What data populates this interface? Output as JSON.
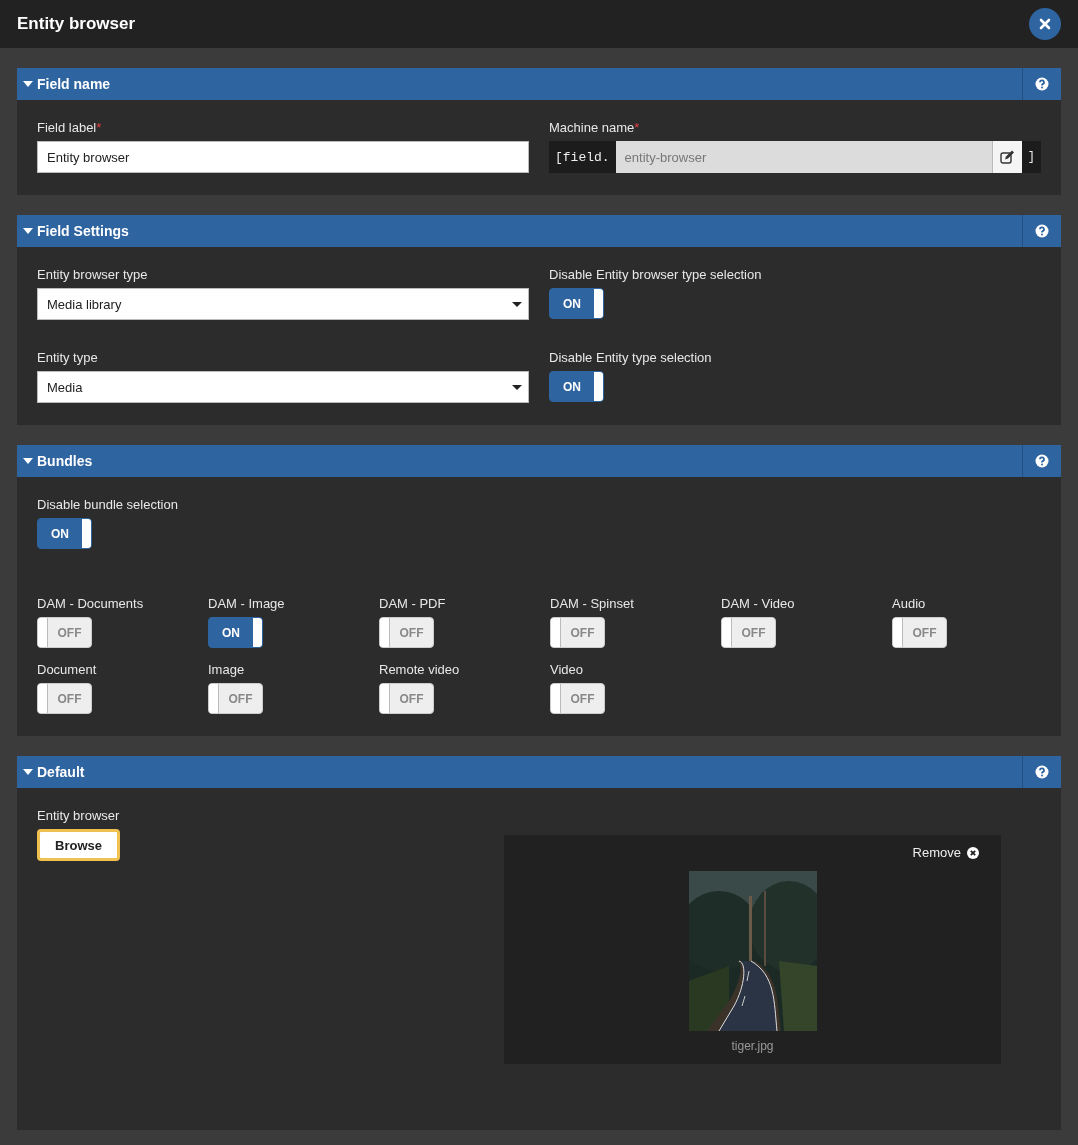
{
  "window": {
    "title": "Entity browser"
  },
  "sections": [
    {
      "kind": "name",
      "title": "Field name",
      "expanded": true,
      "field_label": {
        "label": "Field label",
        "required_mark": "*",
        "value": "Entity browser"
      },
      "machine_name": {
        "label": "Machine name",
        "required_mark": "*",
        "prefix": "[field.",
        "value": "entity-browser",
        "suffix": "]"
      }
    },
    {
      "kind": "settings",
      "title": "Field Settings",
      "expanded": true,
      "rows": [
        {
          "select_label": "Entity browser type",
          "select_value": "Media library",
          "toggle_label": "Disable Entity browser type selection",
          "toggle": {
            "on": true,
            "text": "ON"
          }
        },
        {
          "select_label": "Entity type",
          "select_value": "Media",
          "toggle_label": "Disable Entity type selection",
          "toggle": {
            "on": true,
            "text": "ON"
          }
        }
      ]
    },
    {
      "kind": "bundles",
      "title": "Bundles",
      "expanded": true,
      "master": {
        "label": "Disable bundle selection",
        "on": true,
        "text": "ON"
      },
      "bundles": [
        {
          "label": "DAM - Documents",
          "on": false,
          "text": "OFF"
        },
        {
          "label": "DAM - Image",
          "on": true,
          "text": "ON"
        },
        {
          "label": "DAM - PDF",
          "on": false,
          "text": "OFF"
        },
        {
          "label": "DAM - Spinset",
          "on": false,
          "text": "OFF"
        },
        {
          "label": "DAM - Video",
          "on": false,
          "text": "OFF"
        },
        {
          "label": "Audio",
          "on": false,
          "text": "OFF"
        },
        {
          "label": "Document",
          "on": false,
          "text": "OFF"
        },
        {
          "label": "Image",
          "on": false,
          "text": "OFF"
        },
        {
          "label": "Remote video",
          "on": false,
          "text": "OFF"
        },
        {
          "label": "Video",
          "on": false,
          "text": "OFF"
        }
      ]
    },
    {
      "kind": "default",
      "title": "Default",
      "expanded": true,
      "label": "Entity browser",
      "button": {
        "text": "Browse",
        "focused": true
      },
      "remove": "Remove",
      "file_name": "tiger.jpg"
    }
  ]
}
